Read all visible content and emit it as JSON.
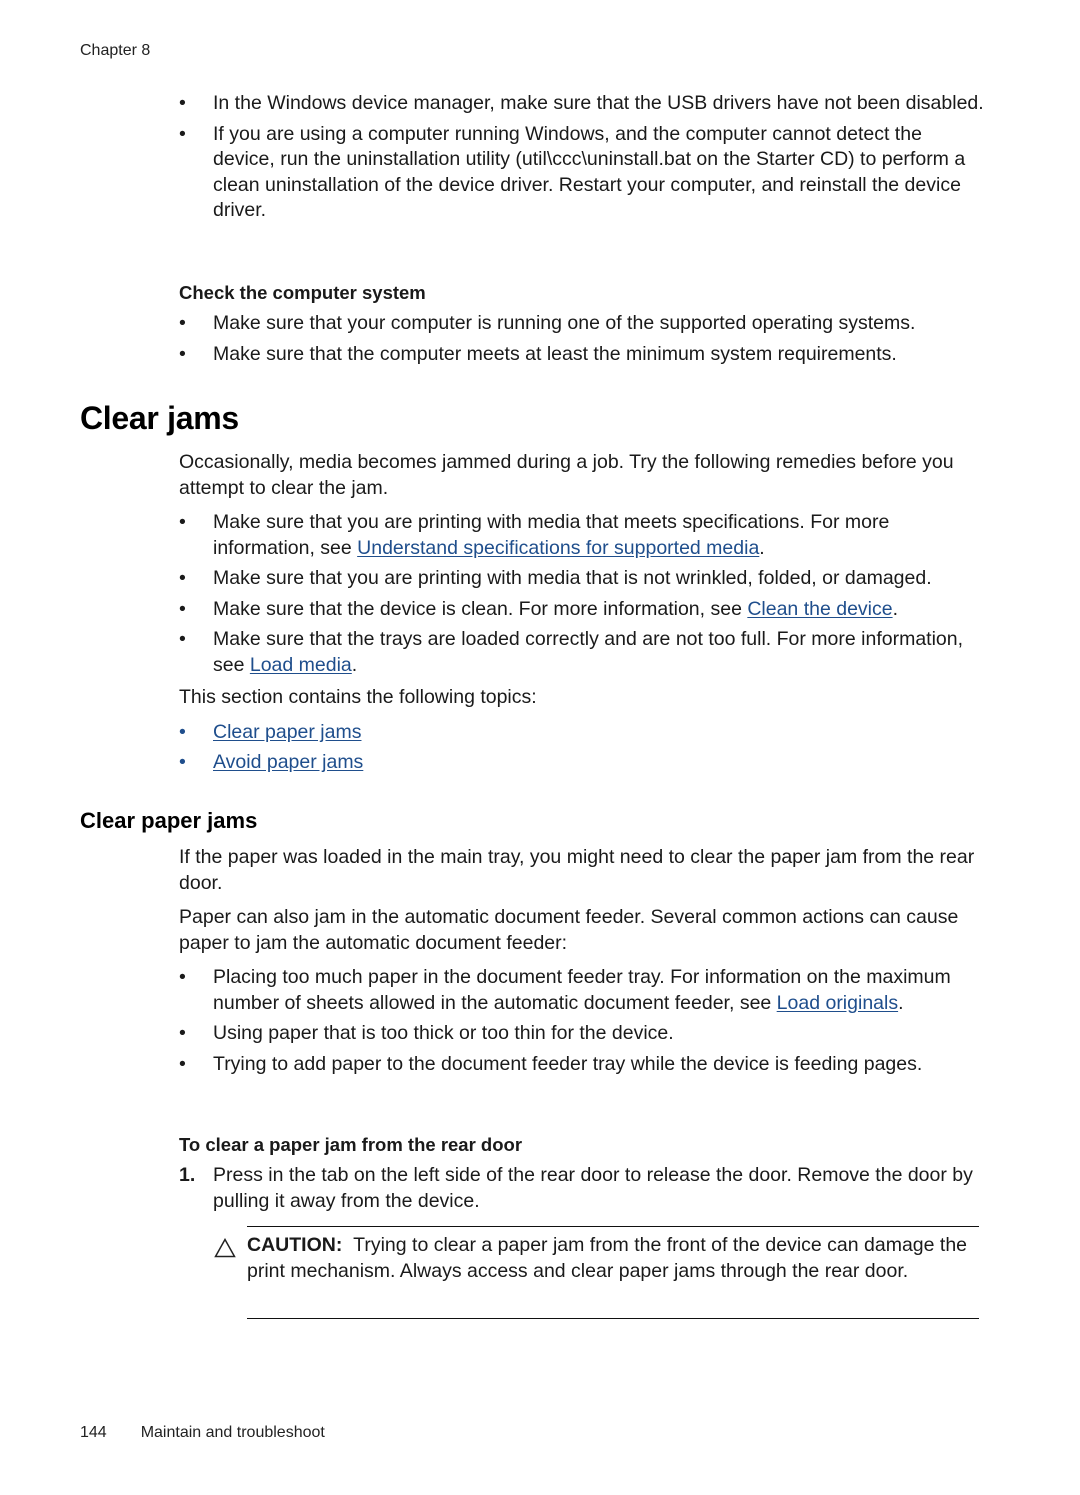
{
  "header": {
    "running_head": "Chapter 8"
  },
  "intro_bullets": [
    {
      "text": "In the Windows device manager, make sure that the USB drivers have not been disabled."
    },
    {
      "text": "If you are using a computer running Windows, and the computer cannot detect the device, run the uninstallation utility (util\\ccc\\uninstall.bat on the Starter CD) to perform a clean uninstallation of the device driver. Restart your computer, and reinstall the device driver."
    }
  ],
  "check_system": {
    "heading": "Check the computer system",
    "bullets": [
      "Make sure that your computer is running one of the supported operating systems.",
      "Make sure that the computer meets at least the minimum system requirements."
    ]
  },
  "clear_jams": {
    "title": "Clear jams",
    "intro": "Occasionally, media becomes jammed during a job. Try the following remedies before you attempt to clear the jam.",
    "bullets": [
      {
        "before": "Make sure that you are printing with media that meets specifications. For more information, see ",
        "link": "Understand specifications for supported media",
        "after": "."
      },
      {
        "before": "Make sure that you are printing with media that is not wrinkled, folded, or damaged.",
        "link": "",
        "after": ""
      },
      {
        "before": "Make sure that the device is clean. For more information, see ",
        "link": "Clean the device",
        "after": "."
      },
      {
        "before": "Make sure that the trays are loaded correctly and are not too full. For more information, see ",
        "link": "Load media",
        "after": "."
      }
    ],
    "topics_intro": "This section contains the following topics:",
    "topics": [
      "Clear paper jams",
      "Avoid paper jams"
    ]
  },
  "clear_paper_jams": {
    "title": "Clear paper jams",
    "para1": "If the paper was loaded in the main tray, you might need to clear the paper jam from the rear door.",
    "para2": "Paper can also jam in the automatic document feeder. Several common actions can cause paper to jam the automatic document feeder:",
    "bullets": [
      {
        "before": "Placing too much paper in the document feeder tray. For information on the maximum number of sheets allowed in the automatic document feeder, see ",
        "link": "Load originals",
        "after": "."
      },
      {
        "before": "Using paper that is too thick or too thin for the device.",
        "link": "",
        "after": ""
      },
      {
        "before": "Trying to add paper to the document feeder tray while the device is feeding pages.",
        "link": "",
        "after": ""
      }
    ],
    "procedure_heading": "To clear a paper jam from the rear door",
    "steps": [
      {
        "number": "1.",
        "text": "Press in the tab on the left side of the rear door to release the door. Remove the door by pulling it away from the device."
      }
    ],
    "caution": {
      "icon": "warning-triangle-icon",
      "label": "CAUTION:",
      "text": "Trying to clear a paper jam from the front of the device can damage the print mechanism. Always access and clear paper jams through the rear door."
    }
  },
  "footer": {
    "page_number": "144",
    "section_title": "Maintain and troubleshoot"
  },
  "colors": {
    "link": "#1f4e8c",
    "text": "#1a1a1a"
  }
}
